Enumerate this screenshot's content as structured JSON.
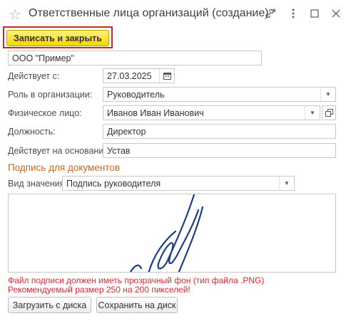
{
  "window": {
    "title": "Ответственные лица организаций (создание) *",
    "star_icon": "star-icon",
    "link_icon": "link-icon",
    "menu_icon": "more-vertical-icon",
    "maximize_icon": "maximize-icon",
    "close_icon": "close-icon"
  },
  "toolbar": {
    "save_close_label": "Записать и закрыть"
  },
  "form": {
    "organization": "ООО \"Пример\"",
    "active_from_label": "Действует с:",
    "active_from_value": "27.03.2025",
    "role_label": "Роль в организации:",
    "role_value": "Руководитель",
    "person_label": "Физическое лицо:",
    "person_value": "Иванов Иван Иванович",
    "position_label": "Должность:",
    "position_value": "Директор",
    "basis_label": "Действует на основании:",
    "basis_value": "Устав"
  },
  "signature": {
    "section_title": "Подпись для документов",
    "kind_label": "Вид значения:",
    "kind_value": "Подпись руководителя",
    "warning_line1": "Файл подписи должен иметь прозрачный фон (тип файла .PNG)",
    "warning_line2": "Рекомендуемый размер 250 на 200 пикселей!",
    "upload_label": "Загрузить с диска",
    "save_label": "Сохранить на диск"
  },
  "colors": {
    "accent_section": "#c46828",
    "warning": "#e4242e",
    "save_button": "#f5d500",
    "highlight_border": "#c6262c",
    "signature_ink": "#1c3f8c"
  }
}
